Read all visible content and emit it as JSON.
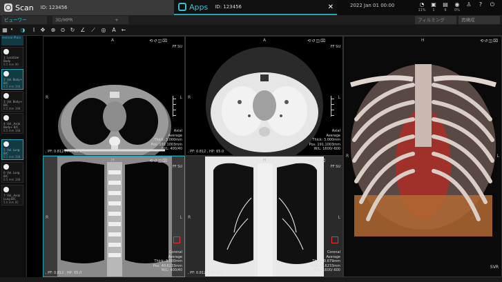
{
  "header": {
    "scan_tab": {
      "label": "Scan",
      "id": "ID: 123456"
    },
    "apps_tab": {
      "label": "Apps",
      "id": "ID: 123456"
    },
    "close": "✕",
    "datetime": "2022 Jan 01 00:00",
    "status_items": [
      {
        "glyph": "◔",
        "label": "11%"
      },
      {
        "glyph": "▣",
        "label": "1"
      },
      {
        "glyph": "▤",
        "label": "9"
      },
      {
        "glyph": "◉",
        "label": "0%"
      },
      {
        "glyph": "♙",
        "label": ""
      },
      {
        "glyph": "?",
        "label": ""
      },
      {
        "glyph": "⏻",
        "label": ""
      }
    ]
  },
  "subtabs": {
    "viewer": "ビューワー",
    "mpr": "3D/MPR",
    "add": "+",
    "filming": "フィルミング",
    "compose": "再構成"
  },
  "left_panel": {
    "header": "Helical Plain",
    "thumbs": [
      {
        "title": "1: Localizer Body",
        "meta": "0.5 mm 00",
        "selected": false
      },
      {
        "title": "2: Vol. Body+ B/C",
        "meta": "0.5 mm 168",
        "selected": true
      },
      {
        "title": "3: Vol. Body+ B/C",
        "meta": "0.5 mm 168",
        "selected": false
      },
      {
        "title": "4: Vol._Axial Body+ B/C",
        "meta": "0.5 mm 168",
        "selected": false
      },
      {
        "title": "5: Vol. Lung B/C",
        "meta": "0.5 mm 168",
        "selected": true
      },
      {
        "title": "6: Vol. Lung B/C",
        "meta": "0.5 mm 168",
        "selected": false
      },
      {
        "title": "7: Vol._Axial Lung B/C",
        "meta": "5.0 mm 81",
        "selected": false
      }
    ]
  },
  "viewports": [
    {
      "top": "A",
      "left": "R",
      "right": "L",
      "corner": "FF SU",
      "view": "Axial",
      "mode": "Average",
      "thick": "Thick: 3.000mm",
      "pos": "Pos: 191.1003mm",
      "wl": "W/L: 400/40",
      "bottom_left": ", PF: 0.812 , HP: 65.0"
    },
    {
      "top": "A",
      "left": "R",
      "right": "L",
      "corner": "FF SU",
      "view": "Axial",
      "mode": "Average",
      "thick": "Thick: 3.000mm",
      "pos": "Pos: 191.1003mm",
      "wl": "W/L: 1600/-600",
      "bottom_left": ", PF: 0.812 , HP: 65.0"
    },
    {
      "top": "H",
      "left": "R",
      "right": "L",
      "corner": "",
      "view": "SVR",
      "mode": "",
      "thick": "",
      "pos": "",
      "wl": "",
      "bottom_left": ""
    },
    {
      "top": "H",
      "left": "R",
      "right": "L",
      "corner": "FF SU",
      "view": "Coronal",
      "mode": "Average",
      "thick": "Thick: 3.000mm",
      "pos": "Pos: 40.6233mm",
      "wl": "W/L: 400/40",
      "bottom_left": ", PF: 0.812 , HP: 65.0"
    },
    {
      "top": "H",
      "left": "R",
      "right": "L",
      "corner": "FF SU",
      "view": "Coronal",
      "mode": "Average",
      "thick": "Thick: 0.679mm",
      "pos": "Pos: 40.6233mm",
      "wl": "W/L: 1600/-600",
      "bottom_left": ", PF: 0.812 , HP: 65.0"
    }
  ]
}
